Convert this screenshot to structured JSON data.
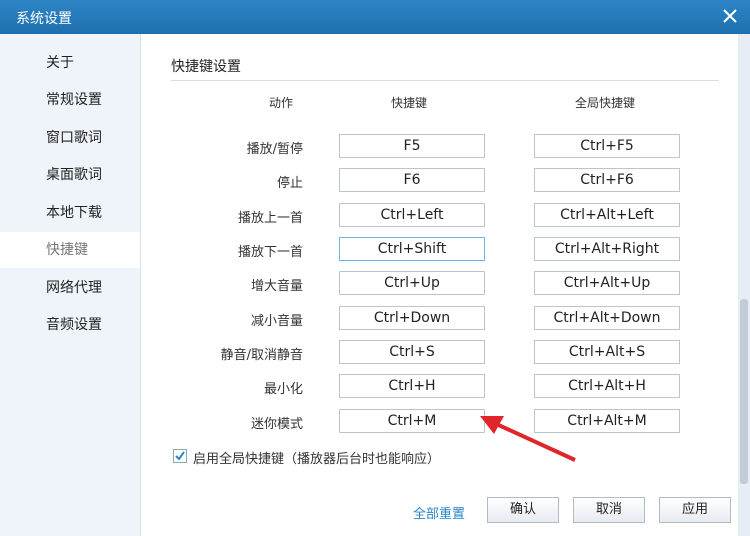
{
  "window": {
    "title": "系统设置"
  },
  "sidebar": {
    "items": [
      {
        "label": "关于"
      },
      {
        "label": "常规设置"
      },
      {
        "label": "窗口歌词"
      },
      {
        "label": "桌面歌词"
      },
      {
        "label": "本地下载"
      },
      {
        "label": "快捷键"
      },
      {
        "label": "网络代理"
      },
      {
        "label": "音频设置"
      }
    ],
    "active": "快捷键"
  },
  "main": {
    "section_title": "快捷键设置",
    "headers": {
      "action": "动作",
      "hotkey": "快捷键",
      "global": "全局快捷键"
    },
    "rows": [
      {
        "action": "播放/暂停",
        "hotkey": "F5",
        "global": "Ctrl+F5"
      },
      {
        "action": "停止",
        "hotkey": "F6",
        "global": "Ctrl+F6"
      },
      {
        "action": "播放上一首",
        "hotkey": "Ctrl+Left",
        "global": "Ctrl+Alt+Left"
      },
      {
        "action": "播放下一首",
        "hotkey": "Ctrl+Shift",
        "global": "Ctrl+Alt+Right"
      },
      {
        "action": "增大音量",
        "hotkey": "Ctrl+Up",
        "global": "Ctrl+Alt+Up"
      },
      {
        "action": "减小音量",
        "hotkey": "Ctrl+Down",
        "global": "Ctrl+Alt+Down"
      },
      {
        "action": "静音/取消静音",
        "hotkey": "Ctrl+S",
        "global": "Ctrl+Alt+S"
      },
      {
        "action": "最小化",
        "hotkey": "Ctrl+H",
        "global": "Ctrl+Alt+H"
      },
      {
        "action": "迷你模式",
        "hotkey": "Ctrl+M",
        "global": "Ctrl+Alt+M"
      }
    ],
    "global_enable": {
      "checked": true,
      "label": "启用全局快捷键（播放器后台时也能响应）"
    }
  },
  "footer": {
    "reset": "全部重置",
    "ok": "确认",
    "cancel": "取消",
    "apply": "应用"
  },
  "colors": {
    "titlebar": "#1f6fae",
    "accent": "#2a86c9",
    "arrow": "#e0262b"
  }
}
